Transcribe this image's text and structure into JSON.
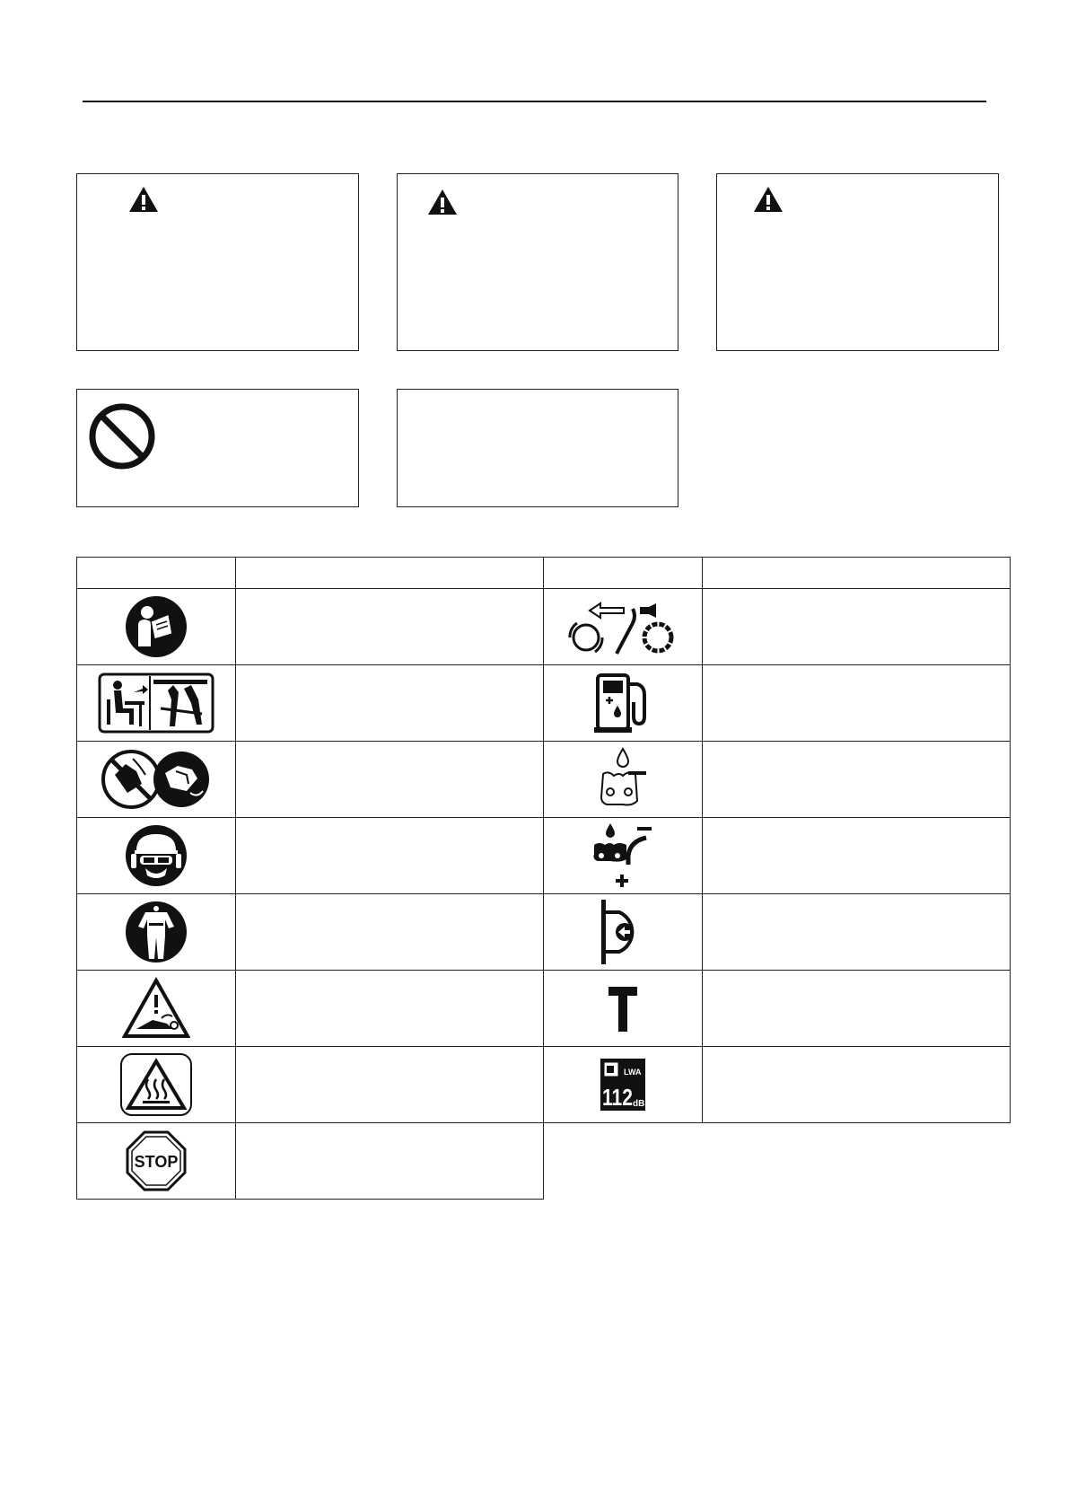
{
  "page": {
    "title": "",
    "warning_boxes": [
      {
        "icon": "warning-triangle-icon",
        "text": ""
      },
      {
        "icon": "warning-triangle-icon",
        "text": ""
      },
      {
        "icon": "warning-triangle-icon",
        "text": ""
      }
    ],
    "notice_boxes": [
      {
        "icon": "prohibition-icon",
        "text": ""
      },
      {
        "icon": "",
        "text": ""
      }
    ]
  },
  "symbol_table": {
    "headers": [
      "",
      "",
      "",
      ""
    ],
    "rows": [
      {
        "left_icon": "read-manual-icon",
        "left_text": "",
        "right_icon": "chain-direction-icon",
        "right_text": ""
      },
      {
        "left_icon": "training-icon",
        "left_text": "",
        "right_icon": "fuel-pump-icon",
        "right_text": ""
      },
      {
        "left_icon": "no-one-hand-icon",
        "left_text": "",
        "right_icon": "chain-oil-icon",
        "right_text": ""
      },
      {
        "left_icon": "head-protection-icon",
        "left_text": "",
        "right_icon": "oil-adjust-icon",
        "right_text": ""
      },
      {
        "left_icon": "protective-clothing-icon",
        "left_text": "",
        "right_icon": "chain-brake-icon",
        "right_text": ""
      },
      {
        "left_icon": "kickback-warning-icon",
        "left_text": "",
        "right_icon": "t-symbol-icon",
        "right_text": ""
      },
      {
        "left_icon": "hot-surface-icon",
        "left_text": "",
        "right_icon": "noise-level-icon",
        "right_text": ""
      },
      {
        "left_icon": "stop-icon",
        "left_text": "",
        "right_icon": "",
        "right_text": ""
      }
    ],
    "noise_label": {
      "value": "112",
      "unit": "dB",
      "prefix": "LWA"
    },
    "stop_label": "STOP"
  }
}
